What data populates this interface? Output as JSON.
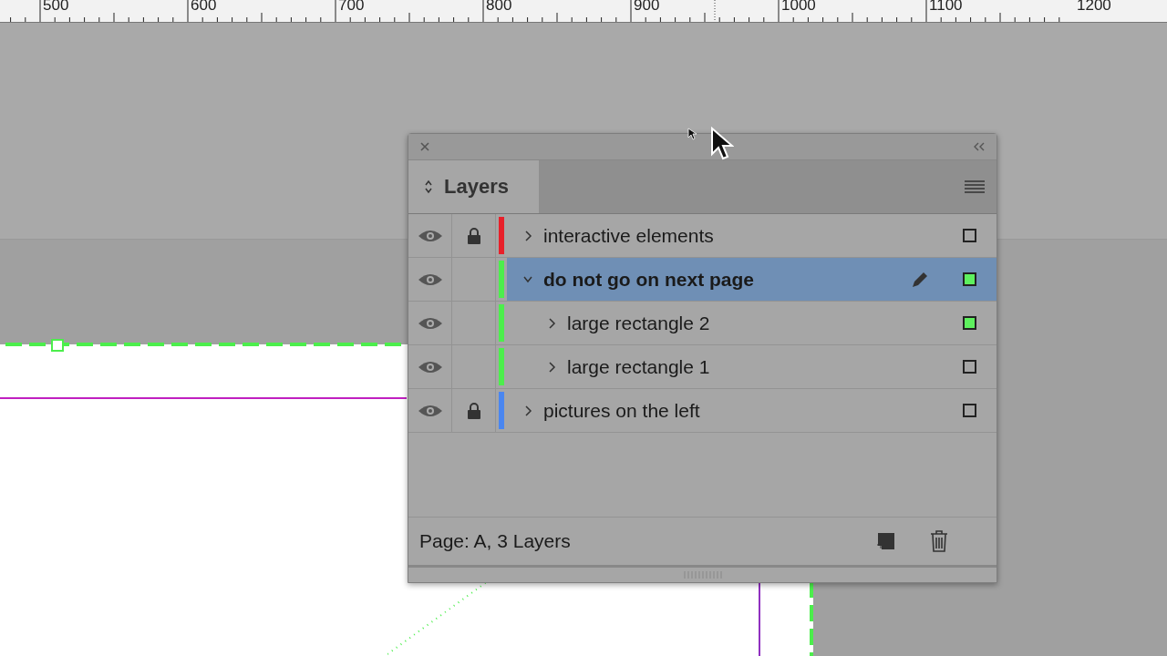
{
  "ruler": {
    "labels": [
      "500",
      "600",
      "700",
      "800",
      "900",
      "1000",
      "1100",
      "1200"
    ]
  },
  "panel": {
    "tab": {
      "label": "Layers",
      "selected": true
    },
    "layers": [
      {
        "name": "interactive elements",
        "visible": true,
        "locked": true,
        "color": "#e8202a",
        "expanded": false,
        "selected": false,
        "active": false,
        "has_selection": false
      },
      {
        "name": "do not go on next page",
        "visible": true,
        "locked": false,
        "color": "#4cee4c",
        "expanded": true,
        "selected": true,
        "active": true,
        "has_selection": true,
        "children": [
          {
            "name": "large rectangle 2",
            "visible": true,
            "locked": false,
            "color": "#4cee4c",
            "expanded": false,
            "selected": false,
            "active": false,
            "has_selection": true
          },
          {
            "name": "large rectangle 1",
            "visible": true,
            "locked": false,
            "color": "#4cee4c",
            "expanded": false,
            "selected": false,
            "active": false,
            "has_selection": false
          }
        ]
      },
      {
        "name": "pictures on the left",
        "visible": true,
        "locked": true,
        "color": "#4a86f0",
        "expanded": false,
        "selected": false,
        "active": false,
        "has_selection": false
      }
    ],
    "status": "Page: A, 3 Layers"
  }
}
